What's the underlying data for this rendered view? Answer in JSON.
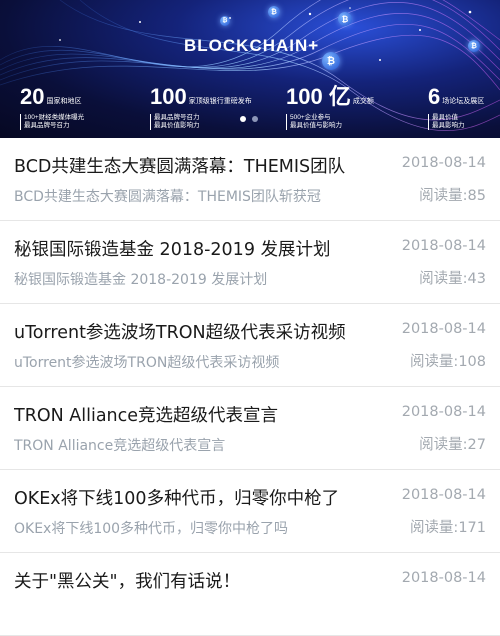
{
  "banner": {
    "title": "BLOCKCHAIN+",
    "coin_glyph": "₿",
    "stats": [
      {
        "num": "20",
        "suffix": "国家和地区",
        "desc1": "100+财经类媒体曝光",
        "desc2": "最具品牌号召力"
      },
      {
        "num": "100",
        "suffix": "家顶级银行重磅发布",
        "desc1": "最具品牌号召力",
        "desc2": "最具价值影响力"
      },
      {
        "num": "100 亿",
        "suffix": "成交额",
        "desc1": "500+企业参与",
        "desc2": "最具价值与影响力"
      },
      {
        "num": "6",
        "suffix": "场论坛及展区",
        "desc1": "最具价值",
        "desc2": "最具影响力"
      }
    ],
    "carousel_pages": 2,
    "carousel_active": 0
  },
  "articles": [
    {
      "title": "BCD共建生态大赛圆满落幕：THEMIS团队",
      "summary": "BCD共建生态大赛圆满落幕：THEMIS团队斩获冠",
      "date": "2018-08-14",
      "reads": "阅读量:85"
    },
    {
      "title": "秘银国际锻造基金 2018-2019 发展计划",
      "summary": "秘银国际锻造基金 2018-2019 发展计划",
      "date": "2018-08-14",
      "reads": "阅读量:43"
    },
    {
      "title": "uTorrent参选波场TRON超级代表采访视频",
      "summary": "uTorrent参选波场TRON超级代表采访视频",
      "date": "2018-08-14",
      "reads": "阅读量:108"
    },
    {
      "title": "TRON Alliance竞选超级代表宣言",
      "summary": "TRON Alliance竞选超级代表宣言",
      "date": "2018-08-14",
      "reads": "阅读量:27"
    },
    {
      "title": "OKEx将下线100多种代币，归零你中枪了",
      "summary": "OKEx将下线100多种代币，归零你中枪了吗",
      "date": "2018-08-14",
      "reads": "阅读量:171"
    },
    {
      "title": "关于\"黑公关\"，我们有话说！",
      "summary": "",
      "date": "2018-08-14",
      "reads": ""
    }
  ]
}
